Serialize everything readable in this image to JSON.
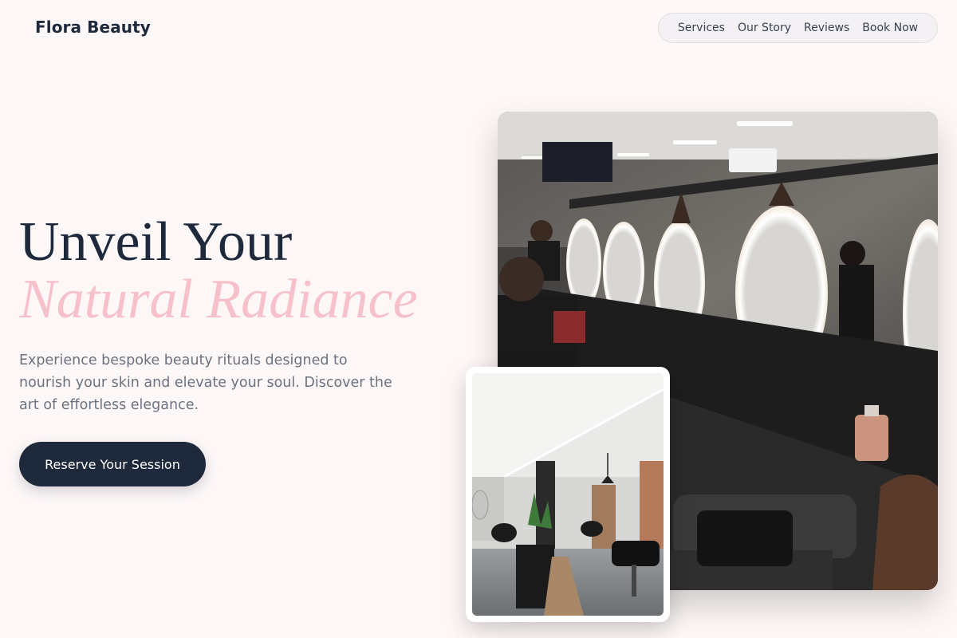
{
  "header": {
    "brand": "Flora Beauty",
    "nav": [
      "Services",
      "Our Story",
      "Reviews",
      "Book Now"
    ]
  },
  "hero": {
    "title_line1": "Unveil Your",
    "title_line2": "Natural Radiance",
    "description": "Experience bespoke beauty rituals designed to nourish your skin and elevate your soul. Discover the art of effortless elegance.",
    "cta_label": "Reserve Your Session"
  },
  "images": {
    "main_alt": "Salon interior with illuminated round mirrors and black counter",
    "secondary_alt": "Salon floor with black styling chairs"
  },
  "colors": {
    "background": "#fdf7f7",
    "primary": "#1e293b",
    "accent_pink": "#f6c1cb",
    "muted_text": "#6b7280"
  }
}
